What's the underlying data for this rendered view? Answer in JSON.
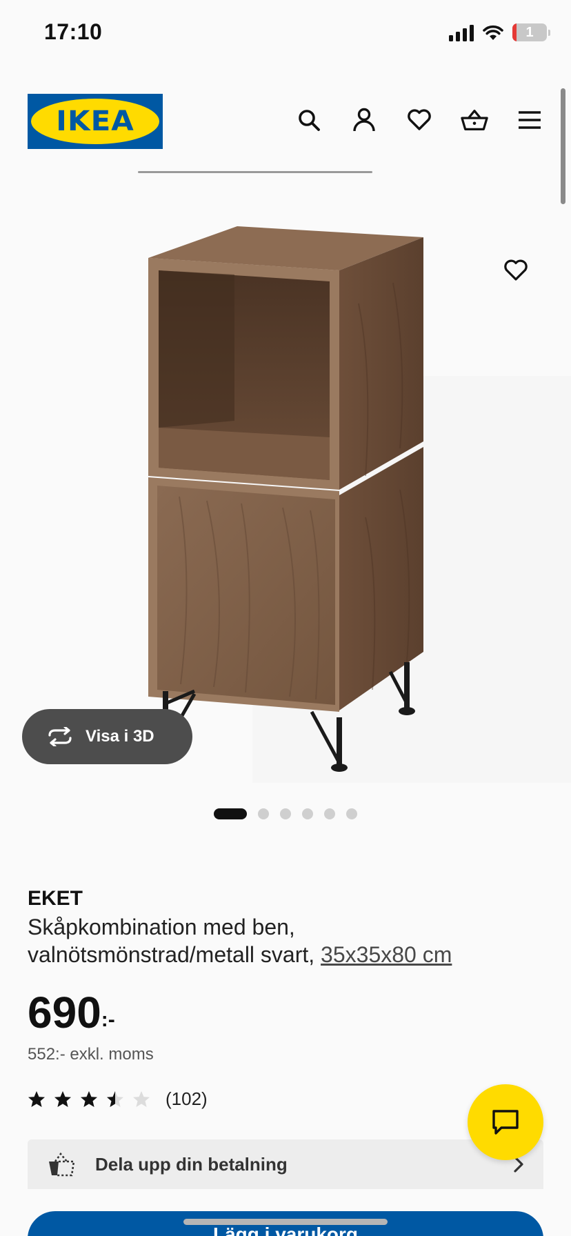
{
  "status_bar": {
    "time": "17:10",
    "battery_level": "1",
    "icons": [
      "signal-icon",
      "wifi-icon",
      "battery-icon"
    ]
  },
  "header": {
    "logo_text": "IKEA",
    "icons": [
      "search-icon",
      "account-icon",
      "heart-icon",
      "basket-icon",
      "menu-icon"
    ],
    "brand_blue": "#0058a3",
    "brand_yellow": "#ffdb00"
  },
  "gallery": {
    "view_3d_label": "Visa i 3D",
    "image_count": 6,
    "active_image_index": 0,
    "favorite_icon": "heart-outline-icon"
  },
  "product": {
    "name": "EKET",
    "description": "Skåpkombination med ben, valnötsmönstrad/metall svart,",
    "size_link": "35x35x80 cm",
    "price": "690",
    "price_suffix": ":-",
    "price_excl": "552:- exkl. moms",
    "rating_value": 3.5,
    "rating_max": 5,
    "review_count": "(102)"
  },
  "payment": {
    "label": "Dela upp din betalning",
    "icon": "installment-icon"
  },
  "cta": {
    "label": "Lägg i varukorg"
  },
  "chat": {
    "icon": "chat-icon"
  }
}
